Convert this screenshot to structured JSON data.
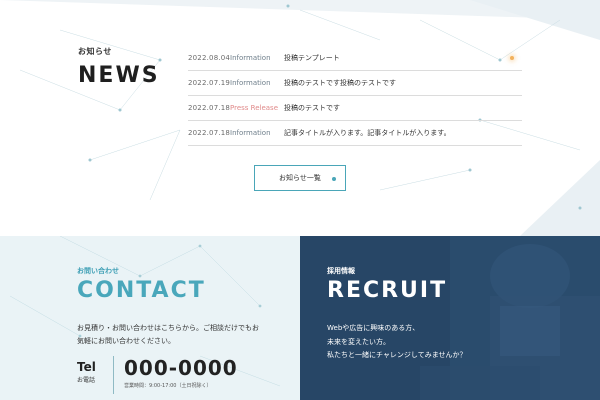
{
  "news": {
    "sub_heading": "お知らせ",
    "heading": "NEWS",
    "items": [
      {
        "date": "2022.08.04",
        "category": "Information",
        "title": "投稿テンプレート"
      },
      {
        "date": "2022.07.19",
        "category": "Information",
        "title": "投稿のテストです投稿のテストです"
      },
      {
        "date": "2022.07.18",
        "category": "Press Release",
        "title": "投稿のテストです"
      },
      {
        "date": "2022.07.18",
        "category": "Information",
        "title": "記事タイトルが入ります。記事タイトルが入ります。"
      }
    ],
    "more_label": "お知らせ一覧"
  },
  "contact": {
    "sub_heading": "お問い合わせ",
    "heading": "CONTACT",
    "desc_line1": "お見積り・お問い合わせはこちらから。ご相談だけでもお",
    "desc_line2": "気軽にお問い合わせください。",
    "tel_label": "Tel",
    "tel_sub": "お電話",
    "tel_number": "000-0000",
    "tel_hours": "営業時間：9:00-17:00（土日祝除く）"
  },
  "recruit": {
    "sub_heading": "採用情報",
    "heading": "RECRUIT",
    "desc_line1": "Webや広告に興味のある方、",
    "desc_line2": "未来を変えたい方。",
    "desc_line3": "私たちと一緒にチャレンジしてみませんか？"
  },
  "colors": {
    "accent": "#49a7bb",
    "press_release": "#e08a8a",
    "recruit_bg": "#2d4e6f",
    "contact_bg": "#eaf3f6"
  }
}
